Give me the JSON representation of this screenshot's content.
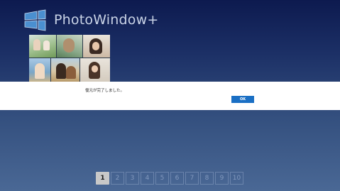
{
  "app": {
    "title": "PhotoWindow+",
    "logo_icon": "window-tiles-icon",
    "accent_color": "#1a6fc4"
  },
  "dialog": {
    "message": "復元が完了しました。",
    "ok_label": "OK"
  },
  "pager": {
    "pages": [
      "1",
      "2",
      "3",
      "4",
      "5",
      "6",
      "7",
      "8",
      "9",
      "10"
    ],
    "current": "1"
  }
}
